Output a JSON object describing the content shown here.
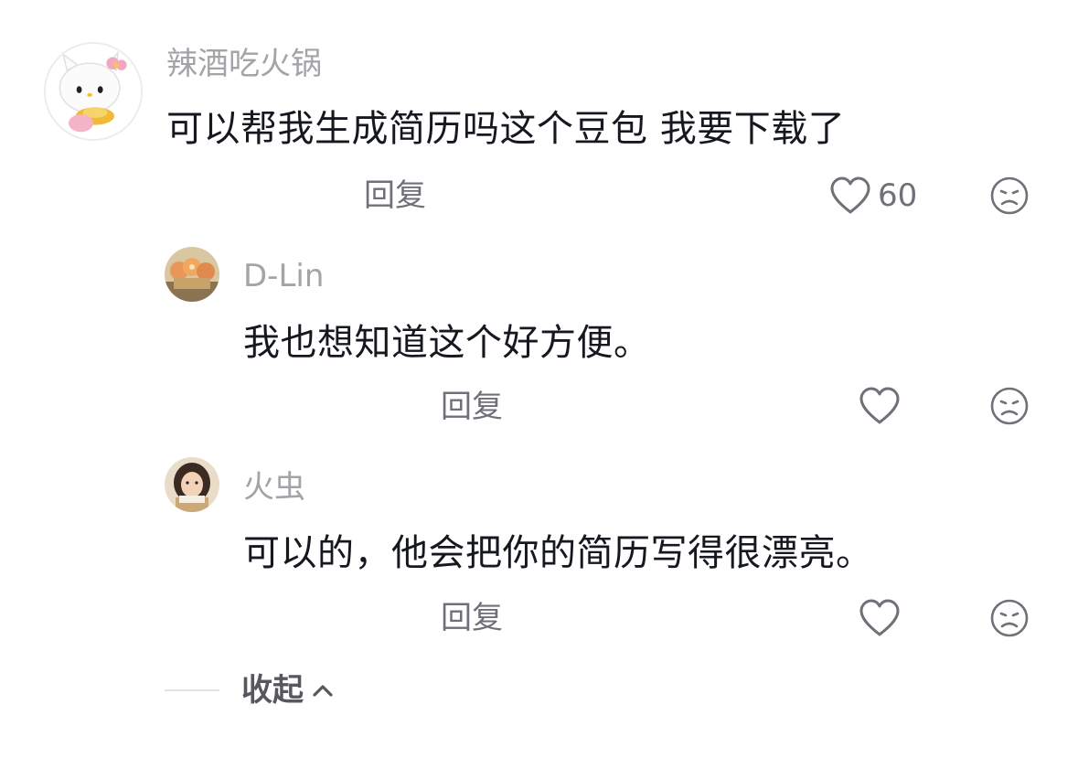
{
  "comments": [
    {
      "username": "辣酒吃火锅",
      "text": "可以帮我生成简历吗这个豆包  我要下载了",
      "reply_label": "回复",
      "like_count": "60",
      "avatar_icon": "hello-kitty-avatar-icon"
    },
    {
      "username": "D-Lin",
      "text": "我也想知道这个好方便。",
      "reply_label": "回复",
      "like_count": "",
      "avatar_icon": "group-photo-avatar-icon"
    },
    {
      "username": "火虫",
      "text": "可以的，他会把你的简历写得很漂亮。",
      "reply_label": "回复",
      "like_count": "",
      "avatar_icon": "girl-reading-avatar-icon"
    }
  ],
  "collapse_label": "收起",
  "icons": {
    "like": "heart-outline-icon",
    "dislike": "frown-face-icon",
    "collapse": "chevron-up-icon"
  },
  "colors": {
    "username": "#a3a3a8",
    "text": "#16181f",
    "meta": "#6f7078",
    "icon": "#8e8f96"
  }
}
